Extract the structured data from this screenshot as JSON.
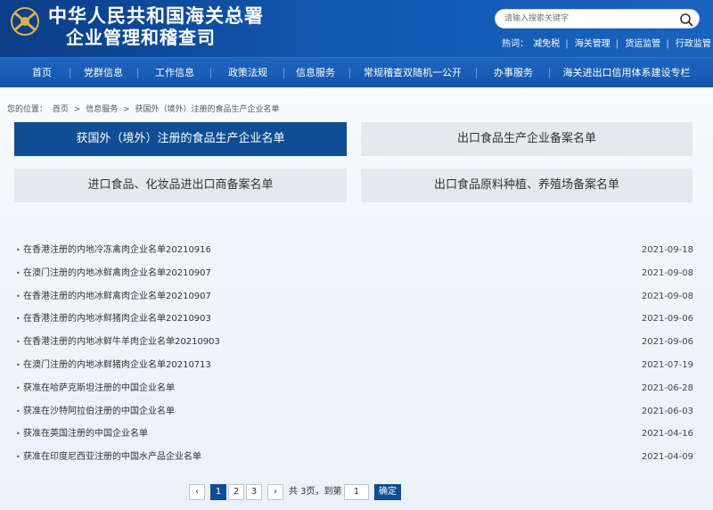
{
  "header": {
    "title_line1": "中华人民共和国海关总署",
    "title_line2": "企业管理和稽查司",
    "search_placeholder": "请输入搜索关键字",
    "hot_label": "热词：",
    "hot_links": [
      "减免税",
      "海关管理",
      "货运监管",
      "行政监管"
    ]
  },
  "nav": {
    "items": [
      "首页",
      "党群信息",
      "工作信息",
      "政策法规",
      "信息服务",
      "常规稽查双随机一公开",
      "办事服务",
      "海关进出口信用体系建设专栏"
    ],
    "active_index": 4
  },
  "breadcrumb": {
    "prefix": "您的位置：",
    "items": [
      "首页",
      "信息服务",
      "获国外（境外）注册的食品生产企业名单"
    ],
    "separator": ">"
  },
  "categories": [
    {
      "label": "获国外（境外）注册的食品生产企业名单",
      "active": true
    },
    {
      "label": "出口食品生产企业备案名单",
      "active": false
    },
    {
      "label": "进口食品、化妆品进出口商备案名单",
      "active": false
    },
    {
      "label": "出口食品原料种植、养殖场备案名单",
      "active": false
    }
  ],
  "list": [
    {
      "title": "在香港注册的内地冷冻禽肉企业名单20210916",
      "date": "2021-09-18"
    },
    {
      "title": "在澳门注册的内地冰鲜禽肉企业名单20210907",
      "date": "2021-09-08"
    },
    {
      "title": "在香港注册的内地冰鲜禽肉企业名单20210907",
      "date": "2021-09-08"
    },
    {
      "title": "在香港注册的内地冰鲜猪肉企业名单20210903",
      "date": "2021-09-06"
    },
    {
      "title": "在香港注册的内地冰鲜牛羊肉企业名单20210903",
      "date": "2021-09-06"
    },
    {
      "title": "在澳门注册的内地冰鲜猪肉企业名单20210713",
      "date": "2021-07-19"
    },
    {
      "title": "获准在哈萨克斯坦注册的中国企业名单",
      "date": "2021-06-28"
    },
    {
      "title": "获准在沙特阿拉伯注册的中国企业名单",
      "date": "2021-06-03"
    },
    {
      "title": "获准在英国注册的中国企业名单",
      "date": "2021-04-16"
    },
    {
      "title": "获准在印度尼西亚注册的中国水产品企业名单",
      "date": "2021-04-09"
    }
  ],
  "pagination": {
    "prev": "‹",
    "pages": [
      "1",
      "2",
      "3"
    ],
    "current": "1",
    "next": "›",
    "total_text": "共 3页，到第",
    "goto_value": "1",
    "confirm": "确定"
  },
  "colors": {
    "header_blue": "#0a3d86",
    "nav_blue": "#1456ad",
    "active_tab": "#0f4d94",
    "inactive_tab": "#e5e8ec"
  },
  "icons": {
    "emblem": "customs-emblem-icon",
    "search": "search-icon"
  }
}
